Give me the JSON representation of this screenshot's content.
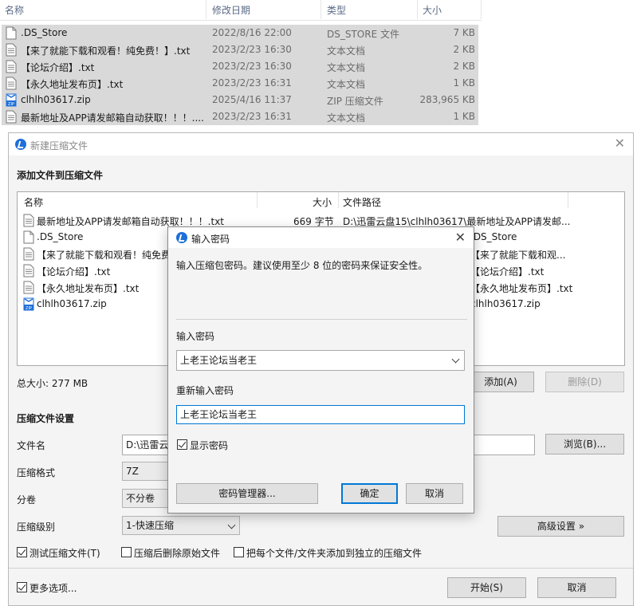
{
  "explorer": {
    "columns": [
      "名称",
      "修改日期",
      "类型",
      "大小"
    ],
    "rows": [
      {
        "name": ".DS_Store",
        "date": "2022/8/16 22:00",
        "type": "DS_STORE 文件",
        "size": "7 KB",
        "icon": "file-icon"
      },
      {
        "name": "【来了就能下载和观看！纯免费！】.txt",
        "date": "2023/2/23 16:30",
        "type": "文本文档",
        "size": "2 KB",
        "icon": "text-file-icon"
      },
      {
        "name": "【论坛介绍】.txt",
        "date": "2023/2/23 16:30",
        "type": "文本文档",
        "size": "2 KB",
        "icon": "text-file-icon"
      },
      {
        "name": "【永久地址发布页】.txt",
        "date": "2023/2/23 16:31",
        "type": "文本文档",
        "size": "1 KB",
        "icon": "text-file-icon"
      },
      {
        "name": "clhlh03617.zip",
        "date": "2025/4/16 11:37",
        "type": "ZIP 压缩文件",
        "size": "283,965 KB",
        "icon": "zip-file-icon"
      },
      {
        "name": "最新地址及APP请发邮箱自动获取！！！....",
        "date": "2023/2/23 16:31",
        "type": "文本文档",
        "size": "1 KB",
        "icon": "text-file-icon"
      }
    ]
  },
  "archive": {
    "title": "新建压缩文件",
    "add_section": "添加文件到压缩文件",
    "list_columns": {
      "name": "名称",
      "size": "大小",
      "path": "文件路径"
    },
    "files": [
      {
        "name": "最新地址及APP请发邮箱自动获取！！！.txt",
        "size": "669 字节",
        "path": "D:\\迅雷云盘15\\clhlh03617\\最新地址及APP请发邮...",
        "icon": "text-file-icon"
      },
      {
        "name": ".DS_Store",
        "size": "",
        "path": ".DS_Store",
        "icon": "file-icon"
      },
      {
        "name": "【来了就能下载和观看！纯免费",
        "size": "",
        "path": "【来了就能下载和观...",
        "icon": "text-file-icon"
      },
      {
        "name": "【论坛介绍】.txt",
        "size": "",
        "path": "【论坛介绍】.txt",
        "icon": "text-file-icon"
      },
      {
        "name": "【永久地址发布页】.txt",
        "size": "",
        "path": "【永久地址发布页】.txt",
        "icon": "text-file-icon"
      },
      {
        "name": "clhlh03617.zip",
        "size": "",
        "path": "clhlh03617.zip",
        "icon": "zip-file-icon"
      }
    ],
    "total_size": "总大小: 277 MB",
    "add_button": "添加(A)",
    "delete_button": "删除(D)",
    "settings_section": "压缩文件设置",
    "filename_label": "文件名",
    "filename_value": "D:\\迅雷云",
    "browse_button": "浏览(B)...",
    "format_label": "压缩格式",
    "format_value": "7Z",
    "volume_label": "分卷",
    "volume_value": "不分卷",
    "level_label": "压缩级别",
    "level_value": "1-快速压缩",
    "advanced_button": "高级设置 »",
    "test_checkbox": "测试压缩文件(T)",
    "test_checked": true,
    "delete_after_checkbox": "压缩后删除原始文件",
    "delete_after_checked": false,
    "separate_checkbox": "把每个文件/文件夹添加到独立的压缩文件",
    "separate_checked": false,
    "more_options_checkbox": "更多选项...",
    "more_options_checked": true,
    "start_button": "开始(S)",
    "cancel_button": "取消"
  },
  "password_dialog": {
    "title": "输入密码",
    "hint": "输入压缩包密码。建议使用至少 8 位的密码来保证安全性。",
    "password_label": "输入密码",
    "password_value": "上老王论坛当老王",
    "reenter_label": "重新输入密码",
    "reenter_value": "上老王论坛当老王",
    "show_password": "显示密码",
    "show_password_checked": true,
    "manager_button": "密码管理器...",
    "ok_button": "确定",
    "cancel_button": "取消"
  },
  "colors": {
    "accent": "#0078d7",
    "row_selected": "#d9d9d9",
    "brand_blue": "#1e6fd9"
  }
}
